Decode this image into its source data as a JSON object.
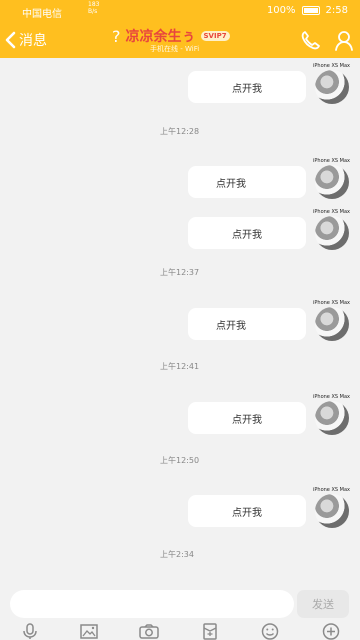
{
  "status": {
    "carrier": "中国电信",
    "network_top": "183",
    "network_bottom": "B/s",
    "battery": "100%",
    "time": "2:58"
  },
  "header": {
    "back_label": "消息",
    "name": "凉凉余生ぅ",
    "vip": "SVIP7",
    "subtitle": "手机在线 - WiFi"
  },
  "messages": [
    {
      "text": "点开我",
      "align": "center",
      "device": "iPhone XS Max"
    },
    {
      "text": "点开我",
      "align": "left",
      "device": "iPhone XS Max"
    },
    {
      "text": "点开我",
      "align": "center",
      "device": "iPhone XS Max"
    },
    {
      "text": "点开我",
      "align": "left",
      "device": "iPhone XS Max"
    },
    {
      "text": "点开我",
      "align": "center",
      "device": "iPhone XS Max"
    },
    {
      "text": "点开我",
      "align": "center",
      "device": "iPhone XS Max"
    }
  ],
  "times": [
    "上午12:28",
    "上午12:37",
    "上午12:41",
    "上午12:50",
    "上午2:34"
  ],
  "composer": {
    "placeholder": "",
    "send_label": "发送"
  },
  "toolbar": [
    "microphone-icon",
    "image-icon",
    "camera-icon",
    "red-packet-icon",
    "emoji-icon",
    "add-icon"
  ],
  "colors": {
    "header": "#ffbf1f",
    "name": "#e8463d",
    "bubble": "#ffffff",
    "background": "#f2f2f2"
  }
}
